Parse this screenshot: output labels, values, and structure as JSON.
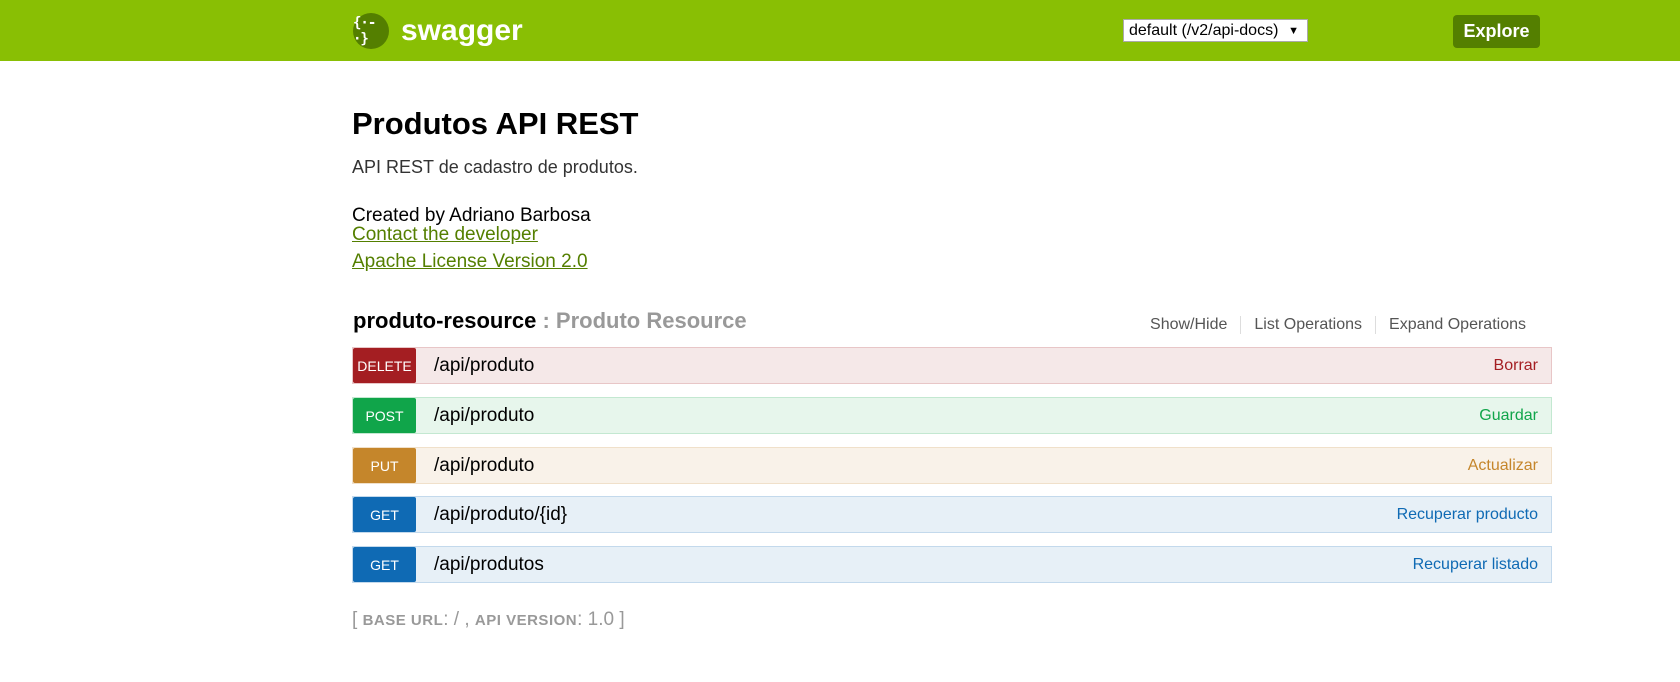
{
  "header": {
    "logo_glyph": "{·-·}",
    "brand": "swagger",
    "api_select": "default (/v2/api-docs)",
    "explore_label": "Explore",
    "bar_color": "#89bf04"
  },
  "info": {
    "title": "Produtos API REST",
    "description": "API REST de cadastro de produtos.",
    "created_by": "Created by Adriano Barbosa",
    "contact_link": "Contact the developer",
    "license_link": "Apache License Version 2.0"
  },
  "resource": {
    "name": "produto-resource",
    "separator": " : ",
    "label": "Produto Resource",
    "actions": [
      "Show/Hide",
      "List Operations",
      "Expand Operations"
    ]
  },
  "operations": [
    {
      "method": "DELETE",
      "path": "/api/produto",
      "summary": "Borrar"
    },
    {
      "method": "POST",
      "path": "/api/produto",
      "summary": "Guardar"
    },
    {
      "method": "PUT",
      "path": "/api/produto",
      "summary": "Actualizar"
    },
    {
      "method": "GET",
      "path": "/api/produto/{id}",
      "summary": "Recuperar producto"
    },
    {
      "method": "GET",
      "path": "/api/produtos",
      "summary": "Recuperar listado"
    }
  ],
  "footer": {
    "open": "[ ",
    "base_url_label": "BASE URL",
    "base_url_value": ": / , ",
    "api_version_label": "API VERSION",
    "api_version_value": ": 1.0 ",
    "close": "]"
  }
}
